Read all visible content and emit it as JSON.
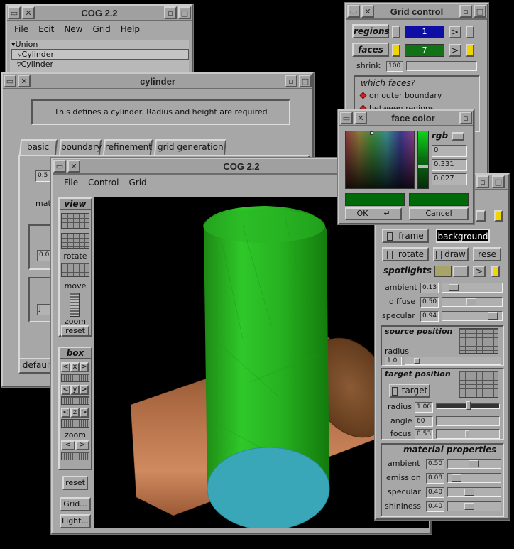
{
  "main_win": {
    "title": "COG 2.2",
    "menu": [
      "File",
      "Ecit",
      "New",
      "Grid",
      "Help"
    ],
    "tree": [
      "▾Union",
      "▿Cylinder",
      "▿Cylinder"
    ]
  },
  "cyl_win": {
    "title": "cylinder",
    "description": "This defines a cylinder. Radius and height are required",
    "tabs": [
      "basic",
      "boundary",
      "refinement",
      "grid generation"
    ],
    "left_values": [
      "0.5",
      "mate",
      "0.0",
      "J"
    ],
    "defaults_label": "defaults"
  },
  "gfx_win": {
    "title": "COG 2.2",
    "menu": [
      "File",
      "Control",
      "Grid"
    ],
    "view_label": "view",
    "rotate_label": "rotate",
    "move_label": "move",
    "zoom_label": "zoom",
    "reset_label": "reset",
    "box_label": "box",
    "box_axes": [
      "x",
      "y",
      "z"
    ],
    "box_zoom_label": "zoom",
    "reset2_label": "reset",
    "grid_btn": "Grid...",
    "light_btn": "Light..."
  },
  "grid_ctrl": {
    "title": "Grid control",
    "regions_label": "regions",
    "regions_value": "1",
    "faces_label": "faces",
    "faces_value": "7",
    "shrink_label": "shrink",
    "shrink_value": "100",
    "which_faces": "which faces?",
    "options": [
      "on outer boundary",
      "between regions"
    ],
    "arrow": ">"
  },
  "face_color": {
    "title": "face color",
    "mode": "rgb",
    "values": [
      "0",
      "0.331",
      "0.027"
    ],
    "ok": "OK",
    "cancel": "Cancel",
    "swatch_color": "#006a0a"
  },
  "light_win": {
    "frame_label": "frame",
    "background_label": "background",
    "rotate_label": "rotate",
    "draw_label": "draw",
    "reset_label": "rese",
    "spotlights_label": "spotlights",
    "arrow": ">",
    "ambient_label": "ambient",
    "ambient_value": "0.13",
    "ambient_level": 0.13,
    "diffuse_label": "diffuse",
    "diffuse_value": "0.50",
    "diffuse_level": 0.5,
    "specular_label": "specular",
    "specular_value": "0.94",
    "specular_level": 0.94,
    "source_position_label": "source position",
    "radius_label": "radius",
    "radius_value": "1.0",
    "target_position_label": "target position",
    "target_btn": "target",
    "tradius_label": "radius",
    "tradius_value": "1.00",
    "angle_label": "angle",
    "angle_value": "60",
    "focus_label": "focus",
    "focus_value": "0.53",
    "material_label": "material properties",
    "m_ambient_label": "ambient",
    "m_ambient_value": "0.50",
    "m_ambient_level": 0.5,
    "m_emission_label": "emission",
    "m_emission_value": "0.08",
    "m_emission_level": 0.08,
    "m_specular_label": "specular",
    "m_specular_value": "0.40",
    "m_specular_level": 0.4,
    "m_shininess_label": "shininess",
    "m_shininess_value": "0.40",
    "m_shininess_level": 0.4
  }
}
